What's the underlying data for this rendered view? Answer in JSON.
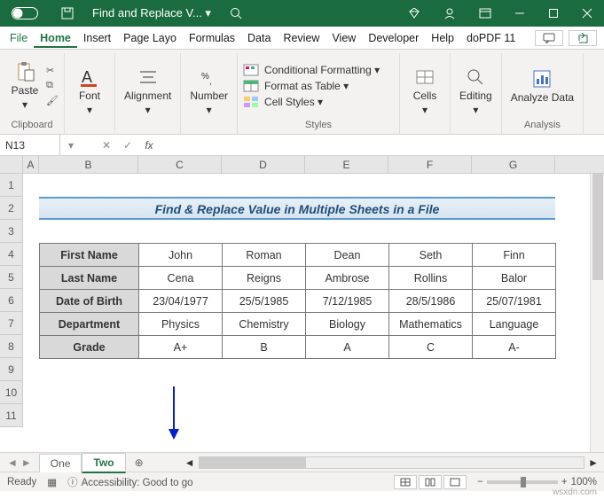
{
  "titlebar": {
    "title": "Find and Replace V... ▾"
  },
  "menu": {
    "tabs": [
      "File",
      "Home",
      "Insert",
      "Page Layo",
      "Formulas",
      "Data",
      "Review",
      "View",
      "Developer",
      "Help",
      "doPDF 11"
    ],
    "active": "Home"
  },
  "ribbon": {
    "clipboard": {
      "paste": "Paste",
      "label": "Clipboard"
    },
    "font": {
      "btn": "Font",
      "label": ""
    },
    "alignment": {
      "btn": "Alignment",
      "label": ""
    },
    "number": {
      "btn": "Number",
      "label": ""
    },
    "styles": {
      "cond": "Conditional Formatting ▾",
      "table": "Format as Table ▾",
      "cell": "Cell Styles ▾",
      "label": "Styles"
    },
    "cells": {
      "btn": "Cells",
      "label": ""
    },
    "editing": {
      "btn": "Editing",
      "label": ""
    },
    "analysis": {
      "btn": "Analyze Data",
      "label": "Analysis"
    }
  },
  "formulabar": {
    "name": "N13",
    "fx": "fx",
    "value": ""
  },
  "columns": [
    "A",
    "B",
    "C",
    "D",
    "E",
    "F",
    "G"
  ],
  "rows": [
    "1",
    "2",
    "3",
    "4",
    "5",
    "6",
    "7",
    "8",
    "9",
    "10",
    "11"
  ],
  "sheet_title": "Find & Replace Value in Multiple Sheets in a File",
  "table": {
    "r1": {
      "h": "First Name",
      "c1": "John",
      "c2": "Roman",
      "c3": "Dean",
      "c4": "Seth",
      "c5": "Finn"
    },
    "r2": {
      "h": "Last Name",
      "c1": "Cena",
      "c2": "Reigns",
      "c3": "Ambrose",
      "c4": "Rollins",
      "c5": "Balor"
    },
    "r3": {
      "h": "Date of Birth",
      "c1": "23/04/1977",
      "c2": "25/5/1985",
      "c3": "7/12/1985",
      "c4": "28/5/1986",
      "c5": "25/07/1981"
    },
    "r4": {
      "h": "Department",
      "c1": "Physics",
      "c2": "Chemistry",
      "c3": "Biology",
      "c4": "Mathematics",
      "c5": "Language"
    },
    "r5": {
      "h": "Grade",
      "c1": "A+",
      "c2": "B",
      "c3": "A",
      "c4": "C",
      "c5": "A-"
    }
  },
  "tabs": {
    "one": "One",
    "two": "Two"
  },
  "status": {
    "ready": "Ready",
    "acc": "Accessibility: Good to go",
    "zoom": "100%"
  },
  "watermark": "wsxdn.com"
}
